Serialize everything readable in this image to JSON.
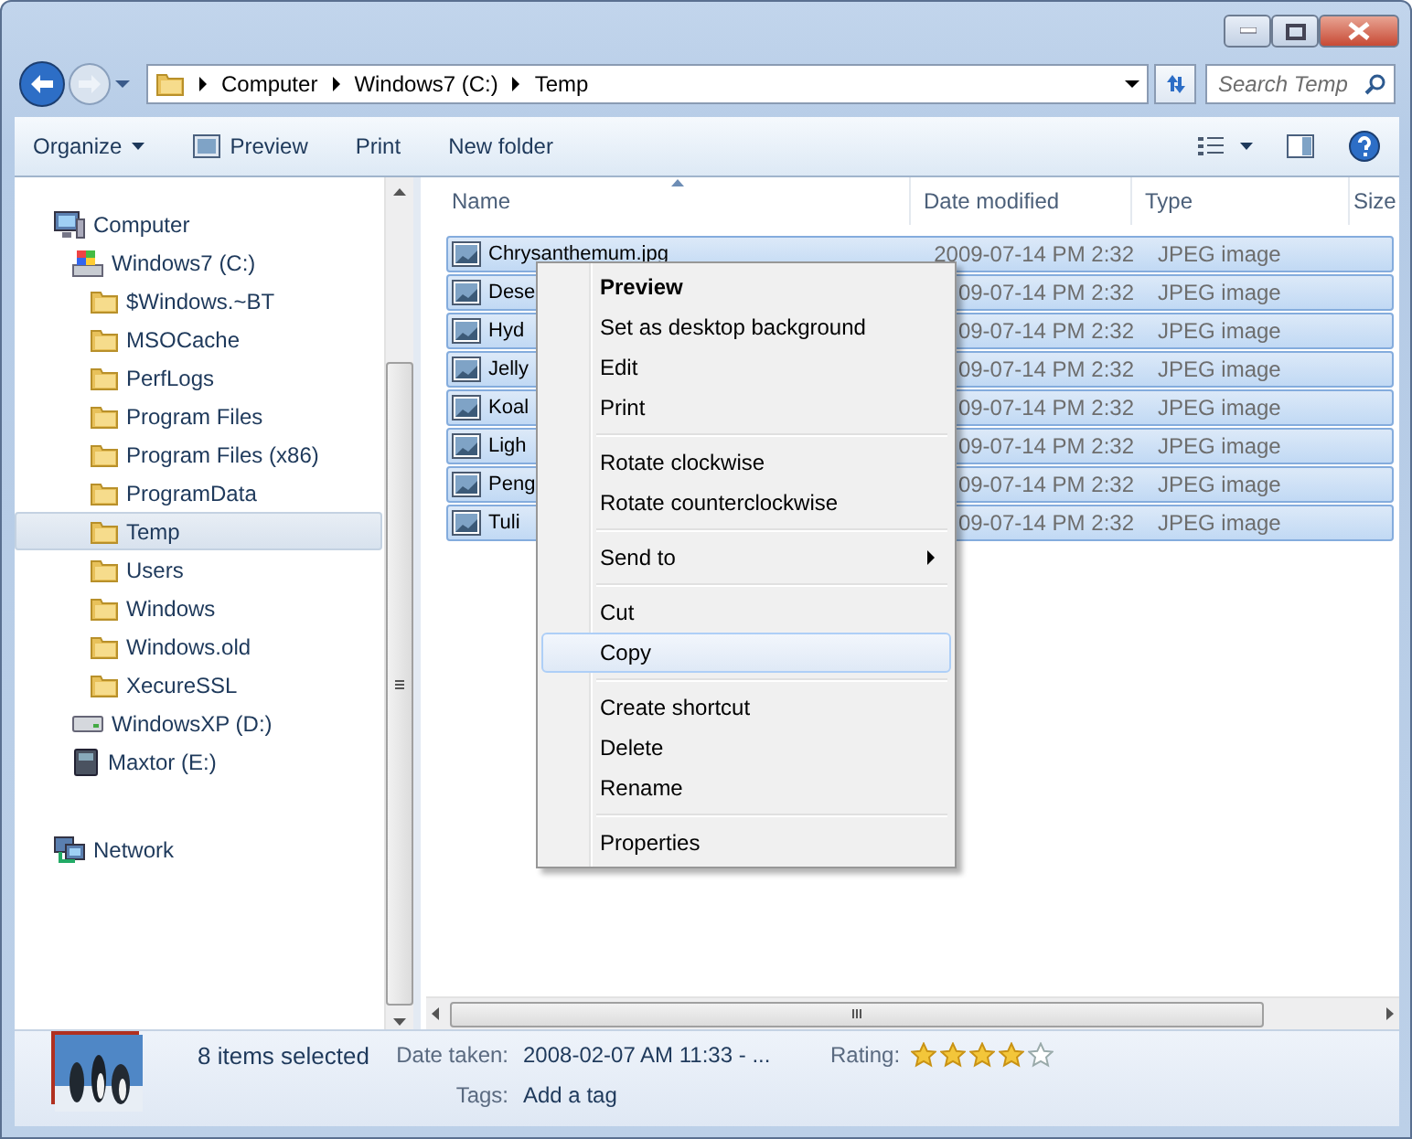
{
  "address": {
    "crumbs": [
      "Computer",
      "Windows7 (C:)",
      "Temp"
    ]
  },
  "search": {
    "placeholder": "Search Temp"
  },
  "toolbar": {
    "buttons": [
      {
        "label": "Organize",
        "kind": "dropdown"
      },
      {
        "label": "Preview",
        "kind": "icon"
      },
      {
        "label": "Print",
        "kind": "plain"
      },
      {
        "label": "New folder",
        "kind": "plain"
      }
    ]
  },
  "nav": {
    "items": [
      {
        "label": "Computer",
        "kind": "computer",
        "selected": false,
        "children": [
          {
            "label": "Windows7 (C:)",
            "kind": "system-drive",
            "selected": false,
            "children": [
              {
                "label": "$Windows.~BT",
                "kind": "folder",
                "selected": false
              },
              {
                "label": "MSOCache",
                "kind": "folder",
                "selected": false
              },
              {
                "label": "PerfLogs",
                "kind": "folder",
                "selected": false
              },
              {
                "label": "Program Files",
                "kind": "folder",
                "selected": false
              },
              {
                "label": "Program Files (x86)",
                "kind": "folder",
                "selected": false
              },
              {
                "label": "ProgramData",
                "kind": "folder",
                "selected": false
              },
              {
                "label": "Temp",
                "kind": "folder",
                "selected": true
              },
              {
                "label": "Users",
                "kind": "folder",
                "selected": false
              },
              {
                "label": "Windows",
                "kind": "folder",
                "selected": false
              },
              {
                "label": "Windows.old",
                "kind": "folder",
                "selected": false
              },
              {
                "label": "XecureSSL",
                "kind": "folder",
                "selected": false
              }
            ]
          },
          {
            "label": "WindowsXP (D:)",
            "kind": "drive",
            "selected": false
          },
          {
            "label": "Maxtor (E:)",
            "kind": "external-drive",
            "selected": false
          }
        ]
      },
      {
        "label": "Network",
        "kind": "network",
        "selected": false
      }
    ]
  },
  "file_list": {
    "columns": [
      "Name",
      "Date modified",
      "Type",
      "Size"
    ],
    "rows": [
      {
        "name": "Chrysanthemum.jpg",
        "date": "2009-07-14 PM 2:32",
        "type": "JPEG image",
        "selected": true
      },
      {
        "name": "Dese",
        "date": "09-07-14 PM 2:32",
        "type": "JPEG image",
        "selected": true
      },
      {
        "name": "Hyd",
        "date": "09-07-14 PM 2:32",
        "type": "JPEG image",
        "selected": true
      },
      {
        "name": "Jelly",
        "date": "09-07-14 PM 2:32",
        "type": "JPEG image",
        "selected": true
      },
      {
        "name": "Koal",
        "date": "09-07-14 PM 2:32",
        "type": "JPEG image",
        "selected": true
      },
      {
        "name": "Ligh",
        "date": "09-07-14 PM 2:32",
        "type": "JPEG image",
        "selected": true
      },
      {
        "name": "Peng",
        "date": "09-07-14 PM 2:32",
        "type": "JPEG image",
        "selected": true
      },
      {
        "name": "Tuli",
        "date": "09-07-14 PM 2:32",
        "type": "JPEG image",
        "selected": true
      }
    ]
  },
  "context_menu": {
    "items": [
      {
        "kind": "default",
        "label": "Preview",
        "selected": false
      },
      {
        "kind": "item",
        "label": "Set as desktop background",
        "selected": false
      },
      {
        "kind": "item",
        "label": "Edit",
        "selected": false
      },
      {
        "kind": "item",
        "label": "Print",
        "selected": false
      },
      {
        "kind": "separator"
      },
      {
        "kind": "item",
        "label": "Rotate clockwise",
        "selected": false
      },
      {
        "kind": "item",
        "label": "Rotate counterclockwise",
        "selected": false
      },
      {
        "kind": "separator"
      },
      {
        "kind": "submenu",
        "label": "Send to",
        "selected": false
      },
      {
        "kind": "separator"
      },
      {
        "kind": "item",
        "label": "Cut",
        "selected": false
      },
      {
        "kind": "item",
        "label": "Copy",
        "selected": true
      },
      {
        "kind": "separator"
      },
      {
        "kind": "item",
        "label": "Create shortcut",
        "selected": false
      },
      {
        "kind": "item",
        "label": "Delete",
        "selected": false
      },
      {
        "kind": "item",
        "label": "Rename",
        "selected": false
      },
      {
        "kind": "separator"
      },
      {
        "kind": "item",
        "label": "Properties",
        "selected": false
      }
    ]
  },
  "details": {
    "summary": "8 items selected",
    "fields": [
      {
        "label": "Date taken:",
        "value": "2008-02-07 AM 11:33 - ..."
      },
      {
        "label": "Tags:",
        "value": "Add a tag"
      }
    ],
    "rating": {
      "label": "Rating:",
      "stars": 4
    }
  }
}
